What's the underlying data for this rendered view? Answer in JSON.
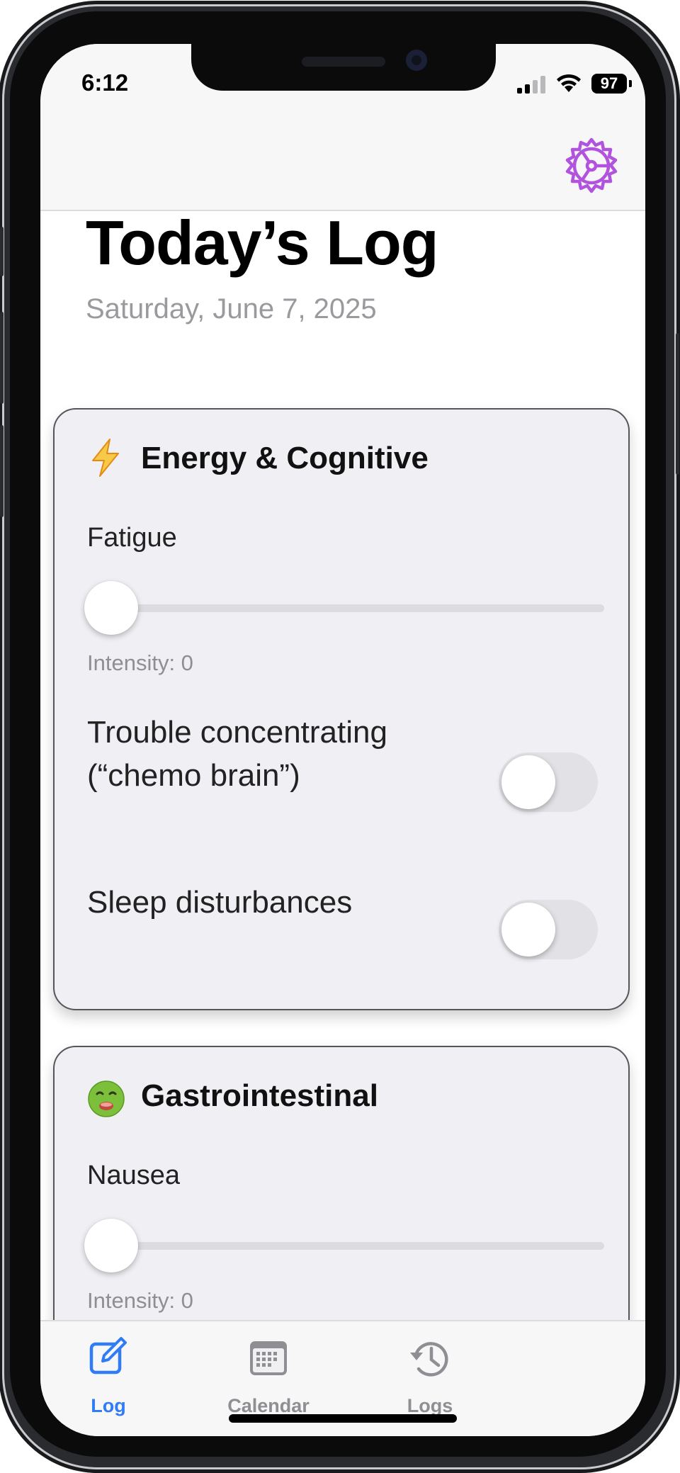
{
  "status_bar": {
    "time": "6:12",
    "battery": "97"
  },
  "header": {
    "title": "Today’s Log",
    "date": "Saturday, June 7, 2025"
  },
  "colors": {
    "accent": "#b153dc",
    "tab_active": "#2f7cf6",
    "tab_inactive": "#8e8e93"
  },
  "icons": {
    "settings": "gear-icon",
    "energy": "lightning-emoji",
    "gastro": "nauseated-face-emoji"
  },
  "sections": [
    {
      "title": "Energy & Cognitive",
      "slider": {
        "label": "Fatigue",
        "intensity_text": "Intensity: 0",
        "value": 0
      },
      "toggles": [
        {
          "label": "Trouble concentrating (“chemo brain”)",
          "on": false
        },
        {
          "label": "Sleep disturbances",
          "on": false
        }
      ]
    },
    {
      "title": "Gastrointestinal",
      "slider": {
        "label": "Nausea",
        "intensity_text": "Intensity: 0",
        "value": 0
      }
    }
  ],
  "tabs": [
    {
      "label": "Log",
      "icon": "edit-icon",
      "active": true
    },
    {
      "label": "Calendar",
      "icon": "calendar-icon",
      "active": false
    },
    {
      "label": "Logs",
      "icon": "history-icon",
      "active": false
    }
  ]
}
